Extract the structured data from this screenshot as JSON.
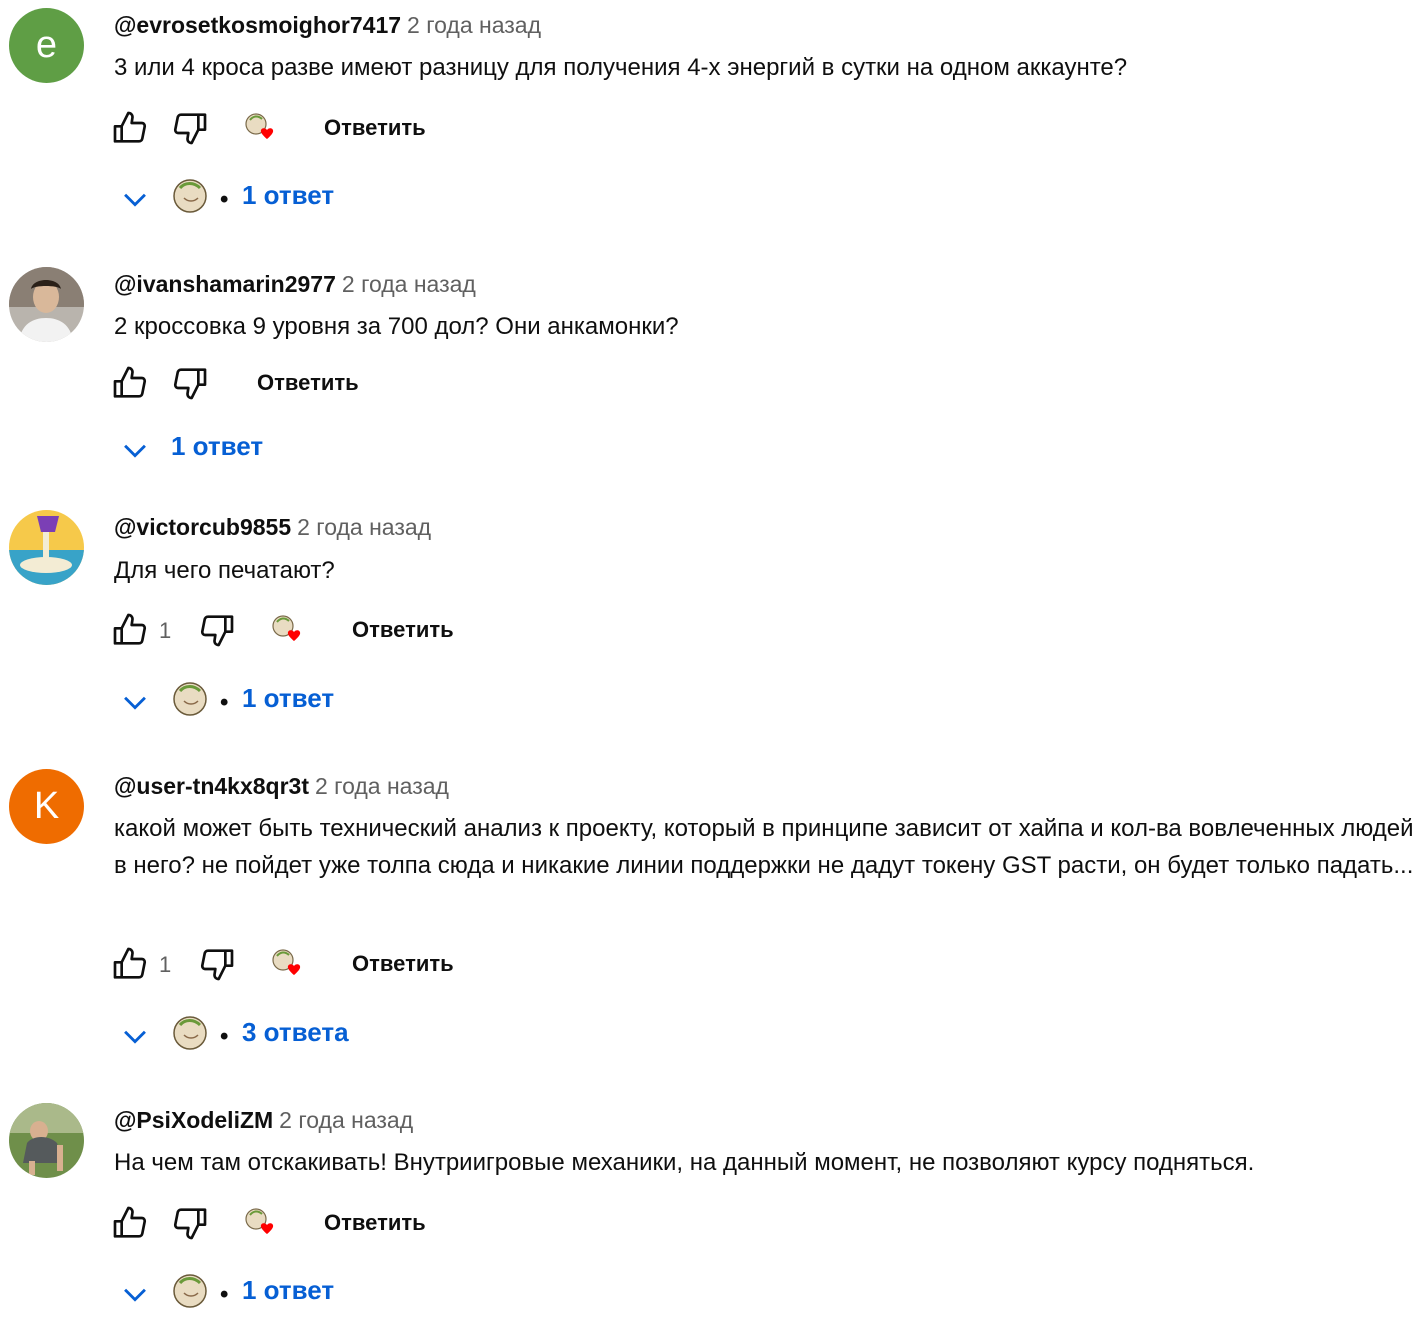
{
  "colors": {
    "link": "#065fd4",
    "time": "#606060",
    "avatar_e": "#5f9e45",
    "avatar_k": "#ef6c00",
    "heart": "#ff0000"
  },
  "comments": [
    {
      "author": "@evrosetkosmoighor7417",
      "time": "2 года назад",
      "text": "3 или 4 кроса разве имеют разницу для получения 4-х энергий в сутки на одном аккаунте?",
      "avatar_letter": "e",
      "likes": "",
      "reply_label": "Ответить",
      "replies": "1 ответ",
      "creator_heart": true
    },
    {
      "author": "@ivanshamarin2977",
      "time": "2 года назад",
      "text": "2 кроссовка 9 уровня за 700 дол? Они анкамонки?",
      "avatar_letter": "",
      "likes": "",
      "reply_label": "Ответить",
      "replies": "1 ответ",
      "creator_heart": false
    },
    {
      "author": "@victorcub9855",
      "time": "2 года назад",
      "text": "Для чего печатают?",
      "avatar_letter": "",
      "likes": "1",
      "reply_label": "Ответить",
      "replies": "1 ответ",
      "creator_heart": true
    },
    {
      "author": "@user-tn4kx8qr3t",
      "time": "2 года назад",
      "text": "какой может быть технический анализ к проекту, который в принципе зависит от хайпа и кол-ва вовлеченных людей в него? не пойдет уже толпа сюда и никакие линии поддержки не дадут токену GST расти, он будет только падать...",
      "avatar_letter": "K",
      "likes": "1",
      "reply_label": "Ответить",
      "replies": "3 ответа",
      "creator_heart": true
    },
    {
      "author": "@PsiXodeliZM",
      "time": "2 года назад",
      "text": "На чем там отскакивать! Внутриигровые механики, на данный момент, не позволяют курсу подняться.",
      "avatar_letter": "",
      "likes": "",
      "reply_label": "Ответить",
      "replies": "1 ответ",
      "creator_heart": false
    }
  ]
}
